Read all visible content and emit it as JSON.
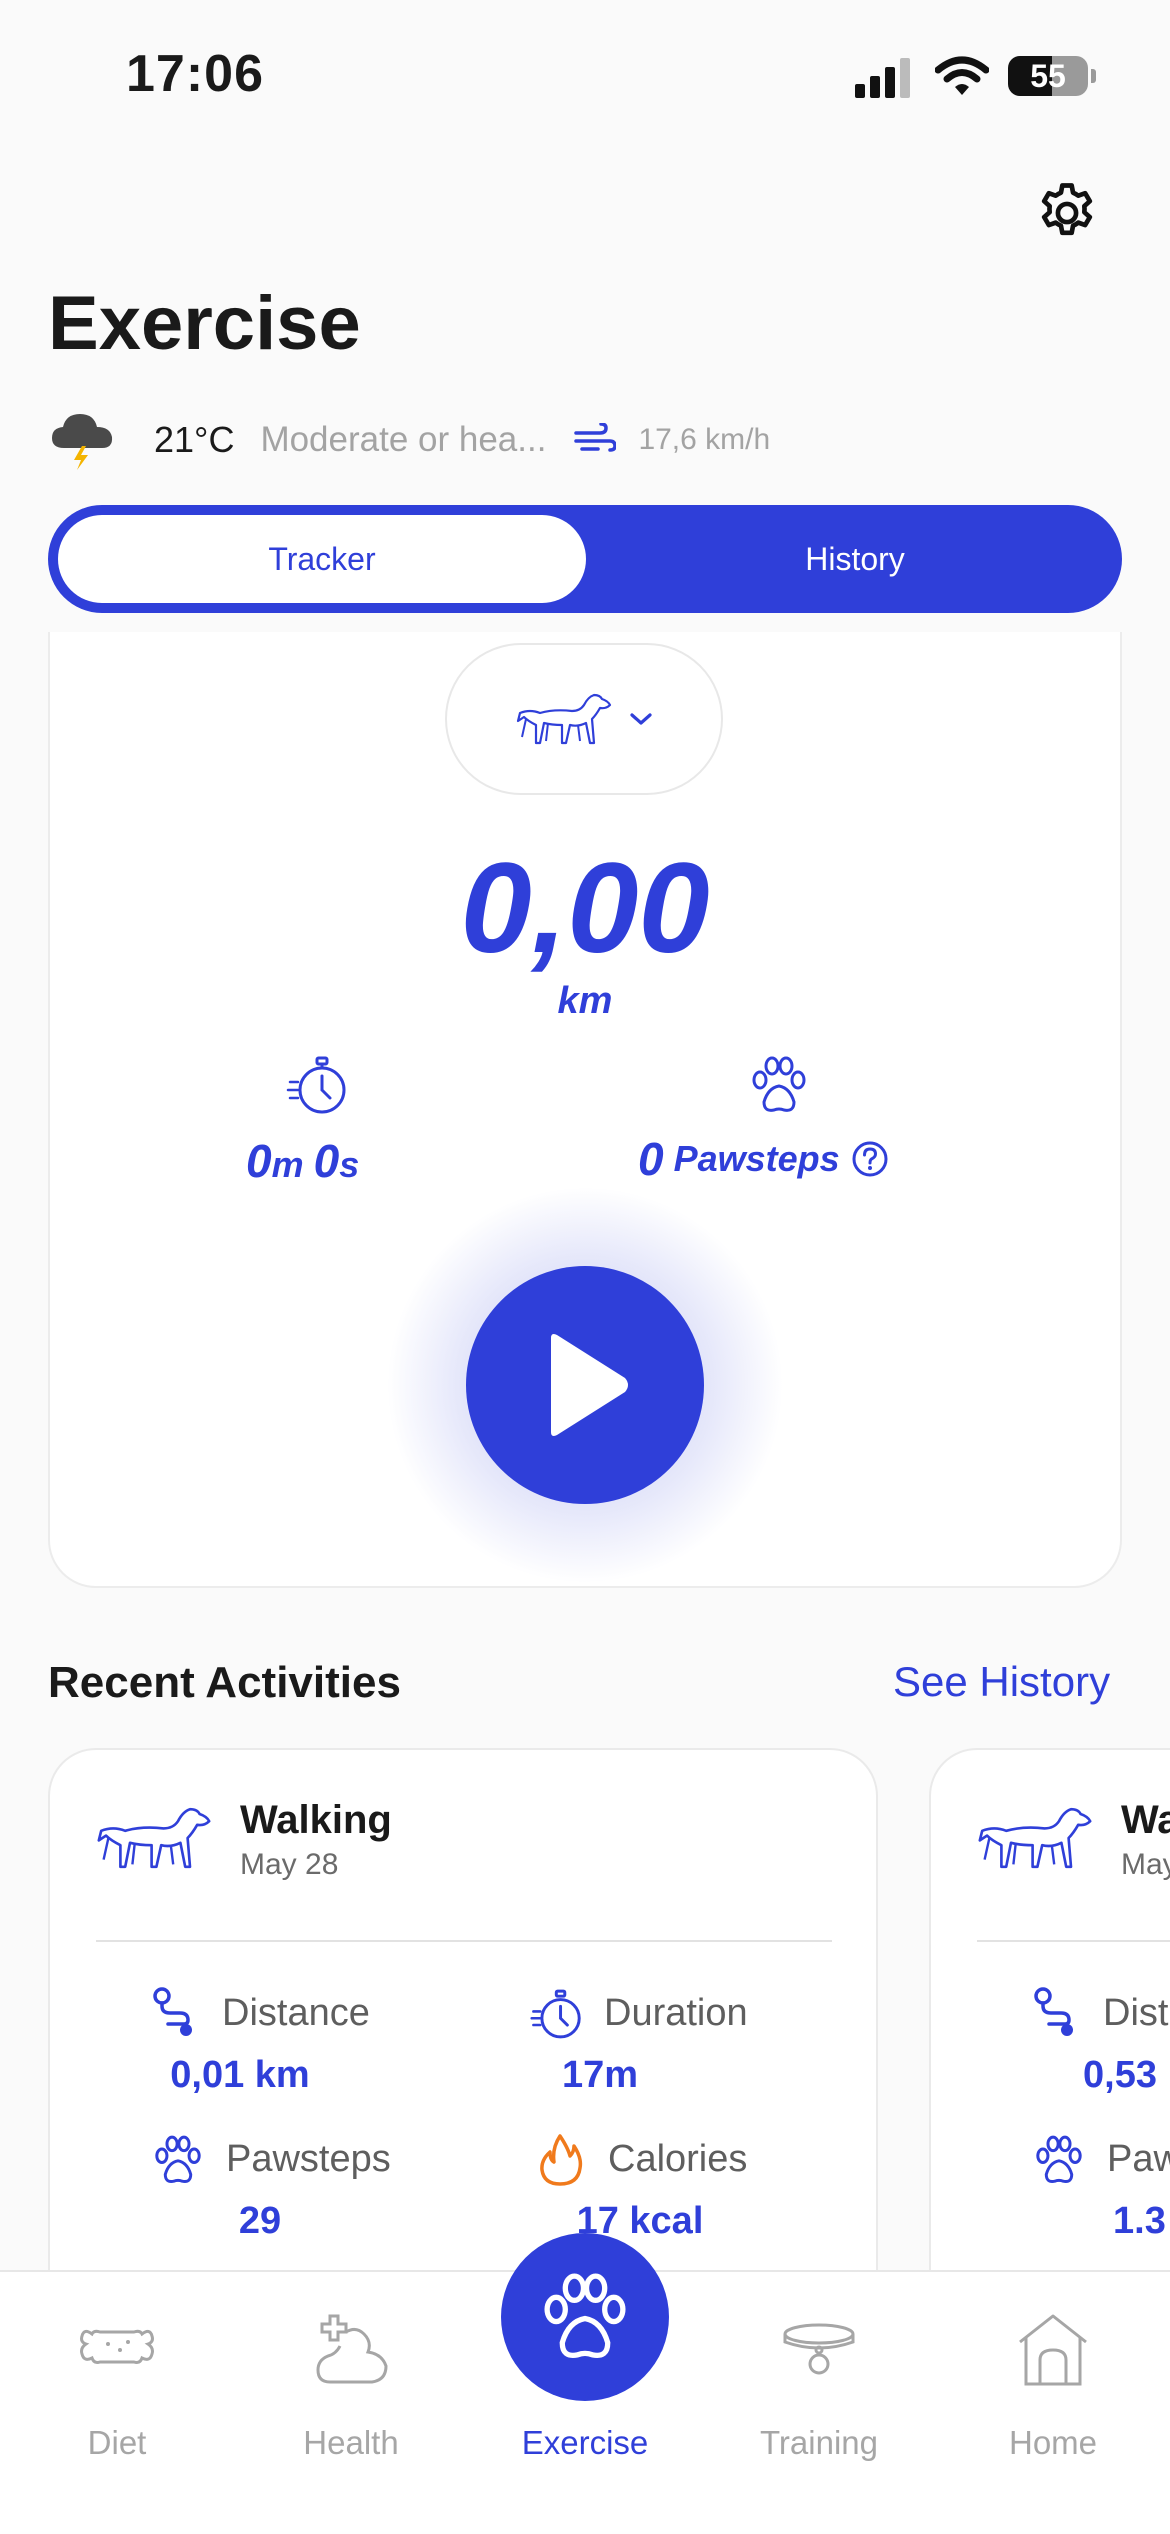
{
  "status_bar": {
    "time": "17:06",
    "battery": "55"
  },
  "header": {
    "title": "Exercise"
  },
  "weather": {
    "temperature": "21°C",
    "condition": "Moderate or hea...",
    "wind_speed": "17,6 km/h"
  },
  "segment": {
    "tracker_label": "Tracker",
    "history_label": "History",
    "active": "Tracker"
  },
  "tracker": {
    "distance": "0,00",
    "distance_unit": "km",
    "duration": {
      "minutes": "0",
      "minutes_unit": "m",
      "seconds": "0",
      "seconds_unit": "s"
    },
    "pawsteps": {
      "value": "0",
      "label": "Pawsteps"
    }
  },
  "recent": {
    "title": "Recent Activities",
    "see_history": "See History",
    "activities": [
      {
        "title": "Walking",
        "date": "May 28",
        "distance_label": "Distance",
        "distance": "0,01 km",
        "duration_label": "Duration",
        "duration": "17m",
        "pawsteps_label": "Pawsteps",
        "pawsteps": "29",
        "calories_label": "Calories",
        "calories": "17 kcal"
      },
      {
        "title": "Wa",
        "date": "May",
        "distance_label": "Dist",
        "distance": "0,53",
        "pawsteps_label": "Paw",
        "pawsteps": "1.3"
      }
    ]
  },
  "tabs": [
    {
      "label": "Diet",
      "icon": "bone-icon"
    },
    {
      "label": "Health",
      "icon": "health-icon"
    },
    {
      "label": "Exercise",
      "icon": "paw-icon",
      "active": true
    },
    {
      "label": "Training",
      "icon": "collar-icon"
    },
    {
      "label": "Home",
      "icon": "doghouse-icon"
    }
  ],
  "colors": {
    "accent": "#2F3FD9",
    "calories": "#F07A1C",
    "muted": "#A6A6A6"
  }
}
